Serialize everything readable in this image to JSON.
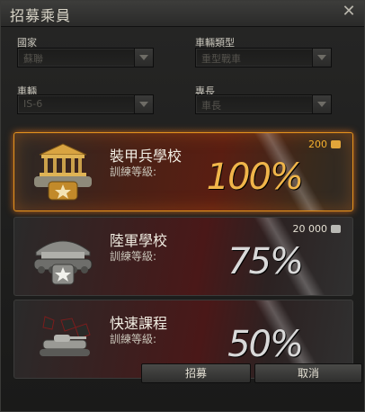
{
  "window": {
    "title": "招募乘員"
  },
  "filters": {
    "nation": {
      "label": "國家",
      "value": "蘇聯"
    },
    "type": {
      "label": "車輛類型",
      "value": "重型戰車"
    },
    "vehicle": {
      "label": "車輛",
      "value": "IS-6"
    },
    "specialty": {
      "label": "專長",
      "value": "車長"
    }
  },
  "options": [
    {
      "name": "裝甲兵學校",
      "training_label": "訓練等級:",
      "price": "200",
      "percent": "100%",
      "currency": "gold"
    },
    {
      "name": "陸軍學校",
      "training_label": "訓練等級:",
      "price": "20 000",
      "percent": "75%",
      "currency": "credits"
    },
    {
      "name": "快速課程",
      "training_label": "訓練等級:",
      "price": "",
      "percent": "50%",
      "currency": ""
    }
  ],
  "buttons": {
    "recruit": "招募",
    "cancel": "取消"
  },
  "colors": {
    "selected_border": "#e7931d",
    "gold": "#f5b02e"
  }
}
